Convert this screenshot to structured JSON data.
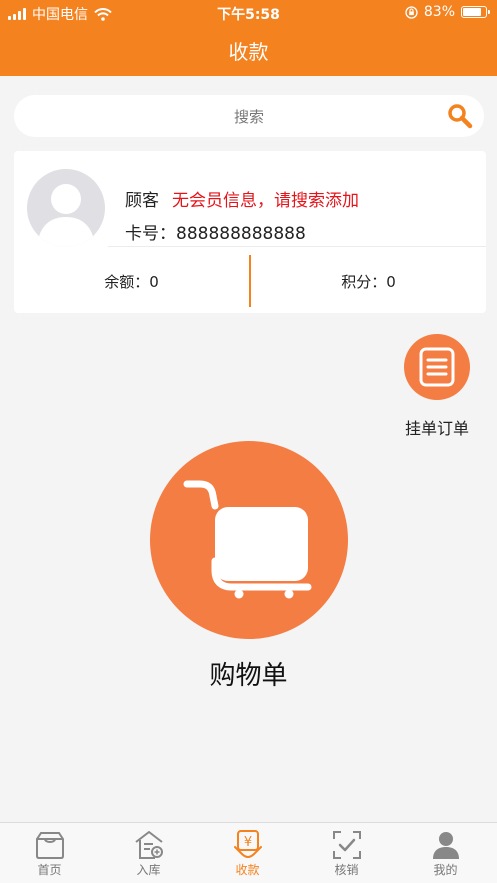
{
  "status_bar": {
    "carrier": "中国电信",
    "time": "下午5:58",
    "battery": "83%"
  },
  "header": {
    "title": "收款"
  },
  "search": {
    "placeholder": "搜索"
  },
  "member_card": {
    "customer_label": "顾客",
    "no_member_notice": "无会员信息，请搜索添加",
    "card_number_text": "卡号：888888888888",
    "balance_text": "余额：0",
    "points_text": "积分：0"
  },
  "hold_order": {
    "label": "挂单订单"
  },
  "shopping_cart": {
    "label": "购物单"
  },
  "tabbar": {
    "items": [
      {
        "label": "首页",
        "icon": "home-icon"
      },
      {
        "label": "入库",
        "icon": "stock-in-icon"
      },
      {
        "label": "收款",
        "icon": "cashier-icon",
        "active": true
      },
      {
        "label": "核销",
        "icon": "verify-icon"
      },
      {
        "label": "我的",
        "icon": "profile-icon"
      }
    ]
  },
  "colors": {
    "brand": "#f4821f",
    "accent_circle": "#f47d44",
    "warning": "#e4141b"
  }
}
